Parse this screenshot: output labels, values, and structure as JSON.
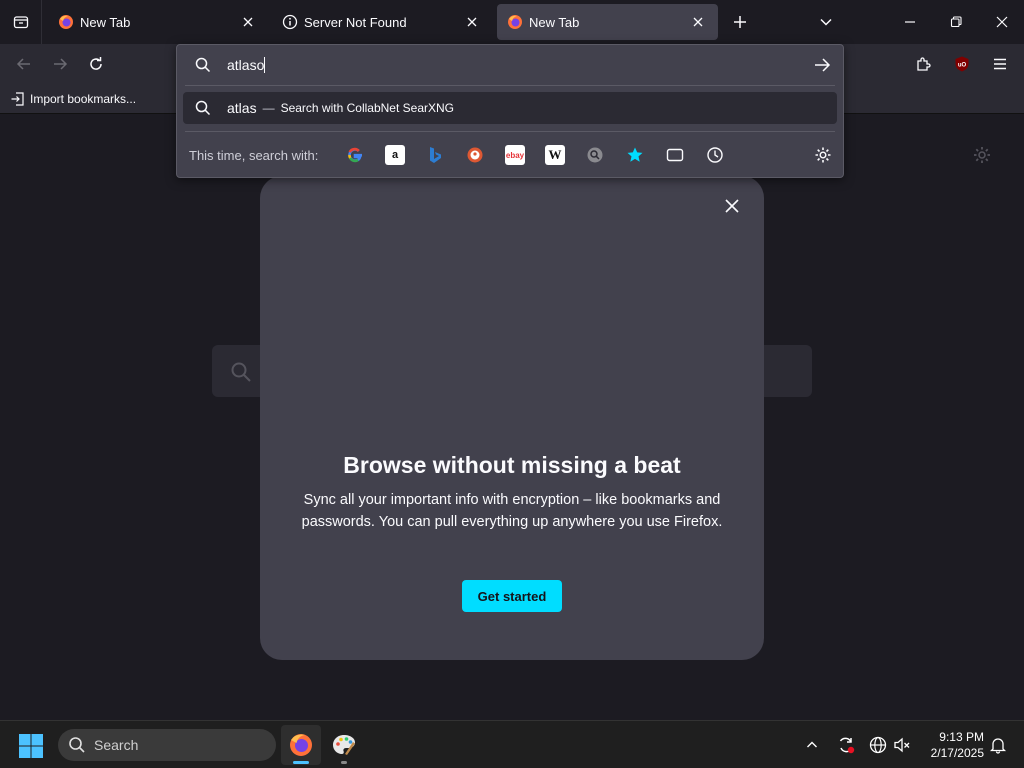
{
  "tabs": [
    {
      "title": "New Tab",
      "favicon": "firefox-icon",
      "active": false
    },
    {
      "title": "Server Not Found",
      "favicon": "info-icon",
      "active": false
    },
    {
      "title": "New Tab",
      "favicon": "firefox-icon",
      "active": true
    }
  ],
  "bookmarks": {
    "import_label": "Import bookmarks..."
  },
  "urlbar": {
    "typed_value": "atlaso",
    "suggestion": {
      "query": "atlas",
      "separator": "—",
      "engine_text": "Search with CollabNet SearXNG"
    },
    "oneoff_label": "This time, search with:",
    "engines": [
      "google",
      "amazon",
      "bing",
      "duckduckgo",
      "ebay",
      "wikipedia",
      "searxng",
      "bookmarks",
      "tabs",
      "history"
    ]
  },
  "dialog": {
    "title": "Browse without missing a beat",
    "body": "Sync all your important info with encryption – like bookmarks and passwords. You can pull everything up anywhere you use Firefox.",
    "button_label": "Get started"
  },
  "taskbar": {
    "search_label": "Search",
    "time": "9:13 PM",
    "date": "2/17/2025"
  },
  "colors": {
    "accent": "#00ddff",
    "chrome_bg": "#2b2a33",
    "content_bg": "#1c1b22",
    "panel_bg": "#42414d"
  }
}
